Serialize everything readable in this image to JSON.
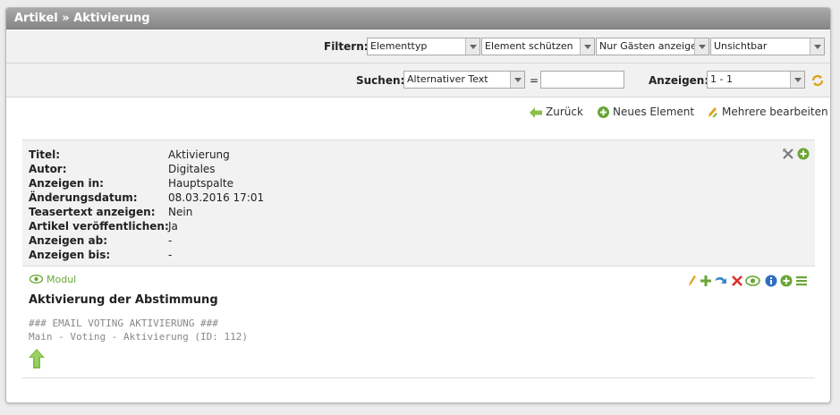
{
  "breadcrumb": {
    "parent": "Artikel",
    "separator": "»",
    "current": "Aktivierung"
  },
  "filter": {
    "label": "Filtern:",
    "selects": [
      "Elementtyp",
      "Element schützen",
      "Nur Gästen anzeigen",
      "Unsichtbar"
    ]
  },
  "search": {
    "label": "Suchen:",
    "field_select": "Alternativer Text",
    "equals": "=",
    "value": "",
    "show_label": "Anzeigen:",
    "show_select": "1 - 1"
  },
  "actions": {
    "back": "Zurück",
    "new_element": "Neues Element",
    "edit_multiple": "Mehrere bearbeiten"
  },
  "details": [
    {
      "key": "Titel:",
      "value": "Aktivierung"
    },
    {
      "key": "Autor:",
      "value": "Digitales"
    },
    {
      "key": "Anzeigen in:",
      "value": "Hauptspalte"
    },
    {
      "key": "Änderungsdatum:",
      "value": "08.03.2016 17:01"
    },
    {
      "key": "Teasertext anzeigen:",
      "value": "Nein"
    },
    {
      "key": "Artikel veröffentlichen:",
      "value": "Ja"
    },
    {
      "key": "Anzeigen ab:",
      "value": "-"
    },
    {
      "key": "Anzeigen bis:",
      "value": "-"
    }
  ],
  "module": {
    "tag": "Modul",
    "title": "Aktivierung der Abstimmung",
    "line1": "### EMAIL VOTING AKTIVIERUNG ###",
    "line2": "Main - Voting - Aktivierung (ID: 112)"
  },
  "colors": {
    "accent_green": "#6aa636",
    "header_gray": "#8f8f8f",
    "delete_red": "#d9302c",
    "info_blue": "#2f6fc2"
  }
}
